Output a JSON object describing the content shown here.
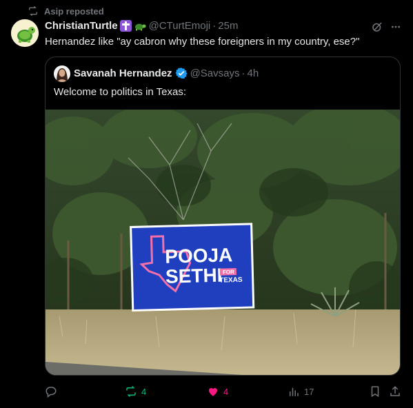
{
  "repost": {
    "label": "Asip reposted"
  },
  "post": {
    "author_name": "ChristianTurtle",
    "handle": "@CTurtEmoji",
    "separator": "·",
    "time": "25m",
    "text": "Hernandez like \"ay cabron why these foreigners in my country, ese?\""
  },
  "quote": {
    "author_name": "Savanah Hernandez",
    "handle": "@Savsays",
    "separator": "·",
    "time": "4h",
    "text": "Welcome to politics in Texas:",
    "image": {
      "sign_line1": "POOJA",
      "sign_line2": "SETHI",
      "sign_for": "FOR",
      "sign_texas": "TEXAS"
    }
  },
  "actions": {
    "reply_count": "",
    "repost_count": "4",
    "like_count": "4",
    "views_count": "17"
  },
  "colors": {
    "background": "#000000",
    "text": "#e7e9ea",
    "muted": "#71767b",
    "repost_green": "#00ba7c",
    "like_pink": "#f91880",
    "verified_blue": "#1d9bf0",
    "sign_blue": "#1f3fbf"
  }
}
